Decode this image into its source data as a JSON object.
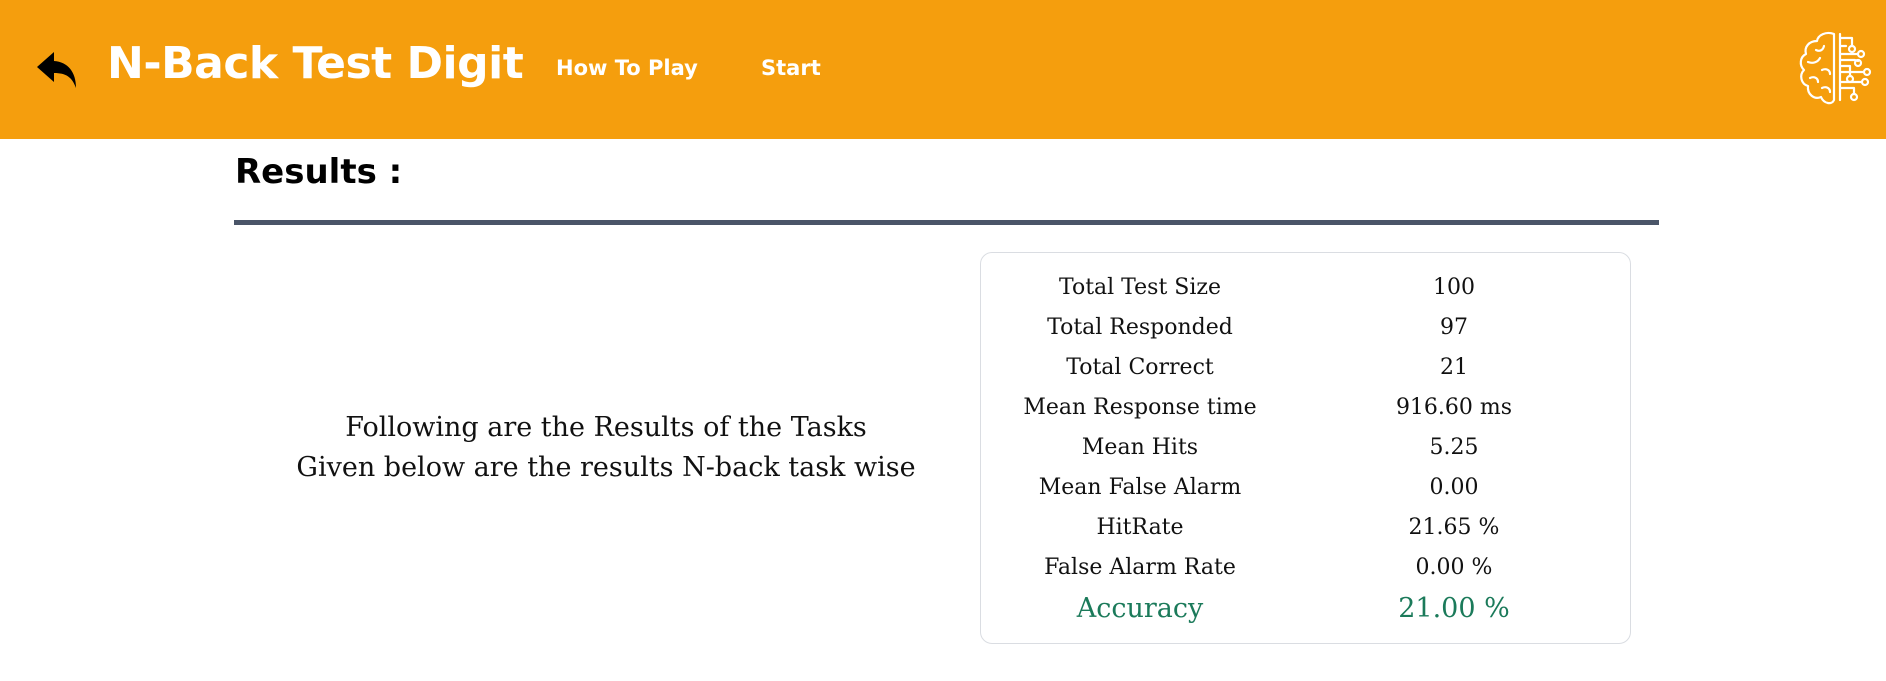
{
  "header": {
    "back_icon": "back-arrow-icon",
    "title": "N-Back Test Digit",
    "nav": [
      {
        "label": "How To Play"
      },
      {
        "label": "Start"
      }
    ],
    "logo_icon": "brain-circuit-icon",
    "background_color": "#f59e0d"
  },
  "main": {
    "section_title": "Results :",
    "intro_lines": [
      "Following are the Results of the Tasks",
      "Given below are the results N-back task wise"
    ],
    "results": [
      {
        "label": "Total Test Size",
        "value": "100"
      },
      {
        "label": "Total Responded",
        "value": "97"
      },
      {
        "label": "Total Correct",
        "value": "21"
      },
      {
        "label": "Mean Response time",
        "value": "916.60 ms"
      },
      {
        "label": "Mean Hits",
        "value": "5.25"
      },
      {
        "label": "Mean False Alarm",
        "value": "0.00"
      },
      {
        "label": "HitRate",
        "value": "21.65 %"
      },
      {
        "label": "False Alarm Rate",
        "value": "0.00 %"
      }
    ],
    "accuracy": {
      "label": "Accuracy",
      "value": "21.00 %"
    },
    "accent_color": "#1b7a5a",
    "divider_color": "#4a5568"
  }
}
